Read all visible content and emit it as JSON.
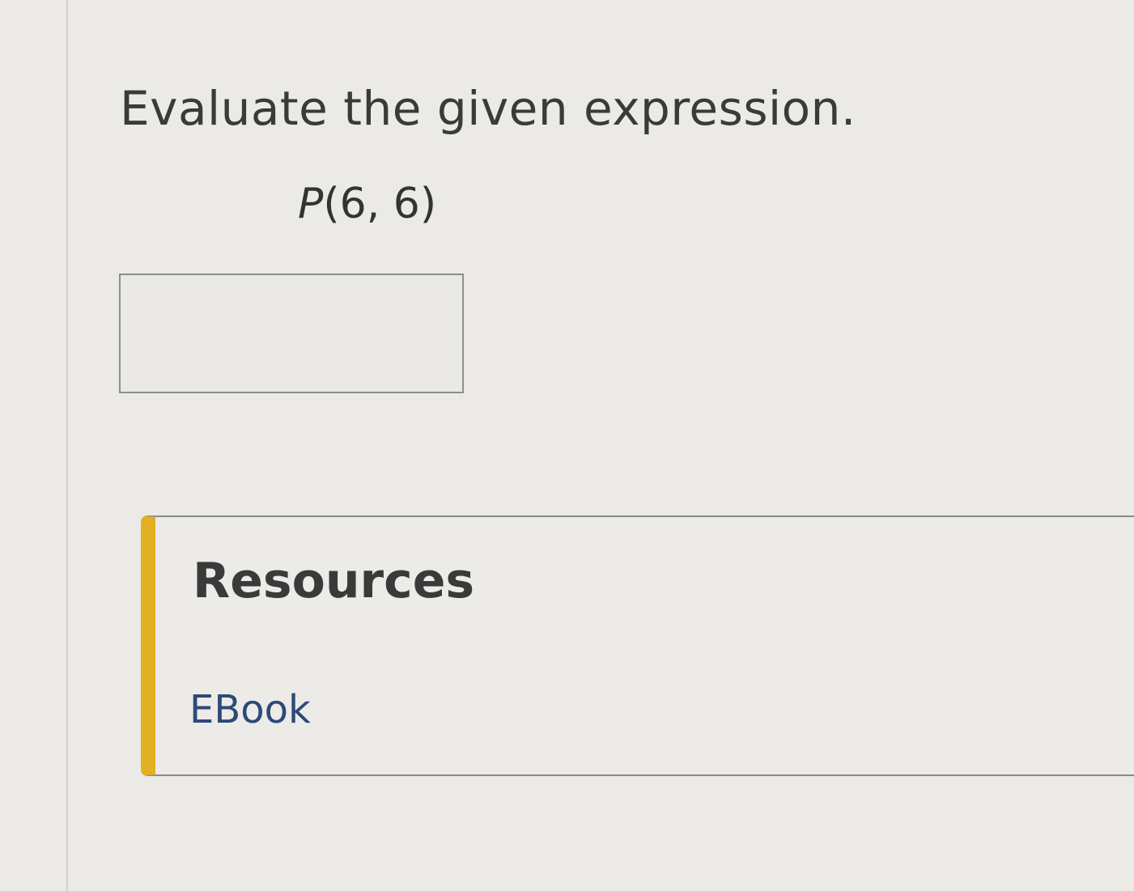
{
  "question": {
    "prompt": "Evaluate the given expression.",
    "expression": {
      "function": "P",
      "arguments": "(6, 6)"
    },
    "answer_input": {
      "value": "",
      "placeholder": ""
    }
  },
  "resources": {
    "heading": "Resources",
    "links": {
      "ebook": "EBook"
    }
  },
  "colors": {
    "accent_bar": "#e2b020",
    "link": "#2c4a78",
    "text": "#3a3a3a"
  }
}
